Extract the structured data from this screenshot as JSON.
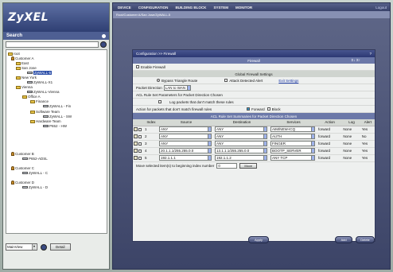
{
  "brand": {
    "logo": "ZyXEL"
  },
  "left": {
    "search_label": "Search",
    "search_value": "",
    "tree": [
      {
        "label": "root",
        "kind": "folder"
      },
      {
        "label": "Customer A",
        "kind": "user"
      },
      {
        "label": "East",
        "kind": "folder"
      },
      {
        "label": "San Jose",
        "kind": "folder"
      },
      {
        "label": "ZyWALL-5",
        "kind": "device"
      },
      {
        "label": "New York",
        "kind": "folder"
      },
      {
        "label": "ZyWALL-X1",
        "kind": "device"
      },
      {
        "label": "Vienna",
        "kind": "folder"
      },
      {
        "label": "ZyWALL-Vienna",
        "kind": "device"
      },
      {
        "label": "Office A",
        "kind": "folder"
      },
      {
        "label": "Finance",
        "kind": "folder"
      },
      {
        "label": "ZyWALL - Fin",
        "kind": "device"
      },
      {
        "label": "Software Team",
        "kind": "folder"
      },
      {
        "label": "ZyWALL - SW",
        "kind": "device"
      },
      {
        "label": "Hardware Team",
        "kind": "folder"
      },
      {
        "label": "P652 - HW",
        "kind": "device"
      },
      {
        "label": "Customer B",
        "kind": "user"
      },
      {
        "label": "P652-ADSL",
        "kind": "device"
      },
      {
        "label": "Customer C",
        "kind": "user"
      },
      {
        "label": "ZyWALL - C",
        "kind": "device"
      },
      {
        "label": "Customer D",
        "kind": "user"
      },
      {
        "label": "ZyWALL - D",
        "kind": "device"
      }
    ],
    "view_select": "MainView",
    "detail_label": "Detail"
  },
  "menu": [
    "DEVICE",
    "CONFIGURATION",
    "BUILDING BLOCK",
    "SYSTEM",
    "MONITOR"
  ],
  "logout": "Logout",
  "breadcrumb": "Root/Customer A/San Jose/ZyWALL-5",
  "panel": {
    "title": "Configuration >> Firewall",
    "help": "?",
    "firewall_head": "Firewall",
    "head_icons": "Σ↓ Σ↑",
    "enable_label": "Enable Firewall",
    "global_head": "Global Firewall Settings",
    "bypass_label": "Bypass Triangle Route",
    "attack_label": "Attack Detected Alert",
    "exit_link": "Exit Settings",
    "direction_label": "Packet Direction",
    "direction_value": "LAN to WAN",
    "acl_params_label": "ACL Rule Set Parameters for Packet Direction Chosen",
    "log_label": "Log packets that don't match these rules",
    "action_label": "Action for packets that don't match firewall rules",
    "forward_label": "Forward",
    "block_label": "Block",
    "summary_head": "ACL Rule Set Summaries for Packet Direction Chosen",
    "columns": [
      "",
      "Index",
      "Source",
      "Destination",
      "Services",
      "Action",
      "Log",
      "Alert"
    ],
    "rules": [
      {
        "index": "1",
        "source": "ANY",
        "destination": "ANY",
        "services": "AIM/NEW-ICQ",
        "action": "forward",
        "log": "None",
        "alert": "Yes"
      },
      {
        "index": "2",
        "source": "ANY",
        "destination": "ANY",
        "services": "AUTH",
        "action": "forward",
        "log": "None",
        "alert": "No"
      },
      {
        "index": "3",
        "source": "ANY",
        "destination": "ANY",
        "services": "FINGER",
        "action": "forward",
        "log": "None",
        "alert": "Yes"
      },
      {
        "index": "4",
        "source": "20.1.1.1/255.255.0.0",
        "destination": "13.1.1.1/255.255.0.0",
        "services": "BOOTP_SERVER",
        "action": "forward",
        "log": "None",
        "alert": "Yes"
      },
      {
        "index": "5",
        "source": "192.1.1.1",
        "destination": "192.1.1.2",
        "services": "ANY TCP",
        "action": "forward",
        "log": "None",
        "alert": "Yes"
      }
    ],
    "move_label": "Move selected item(s) to beginning index number",
    "move_value": "0",
    "move_button": "Move",
    "apply": "Apply",
    "add": "Add",
    "delete": "Delete"
  }
}
